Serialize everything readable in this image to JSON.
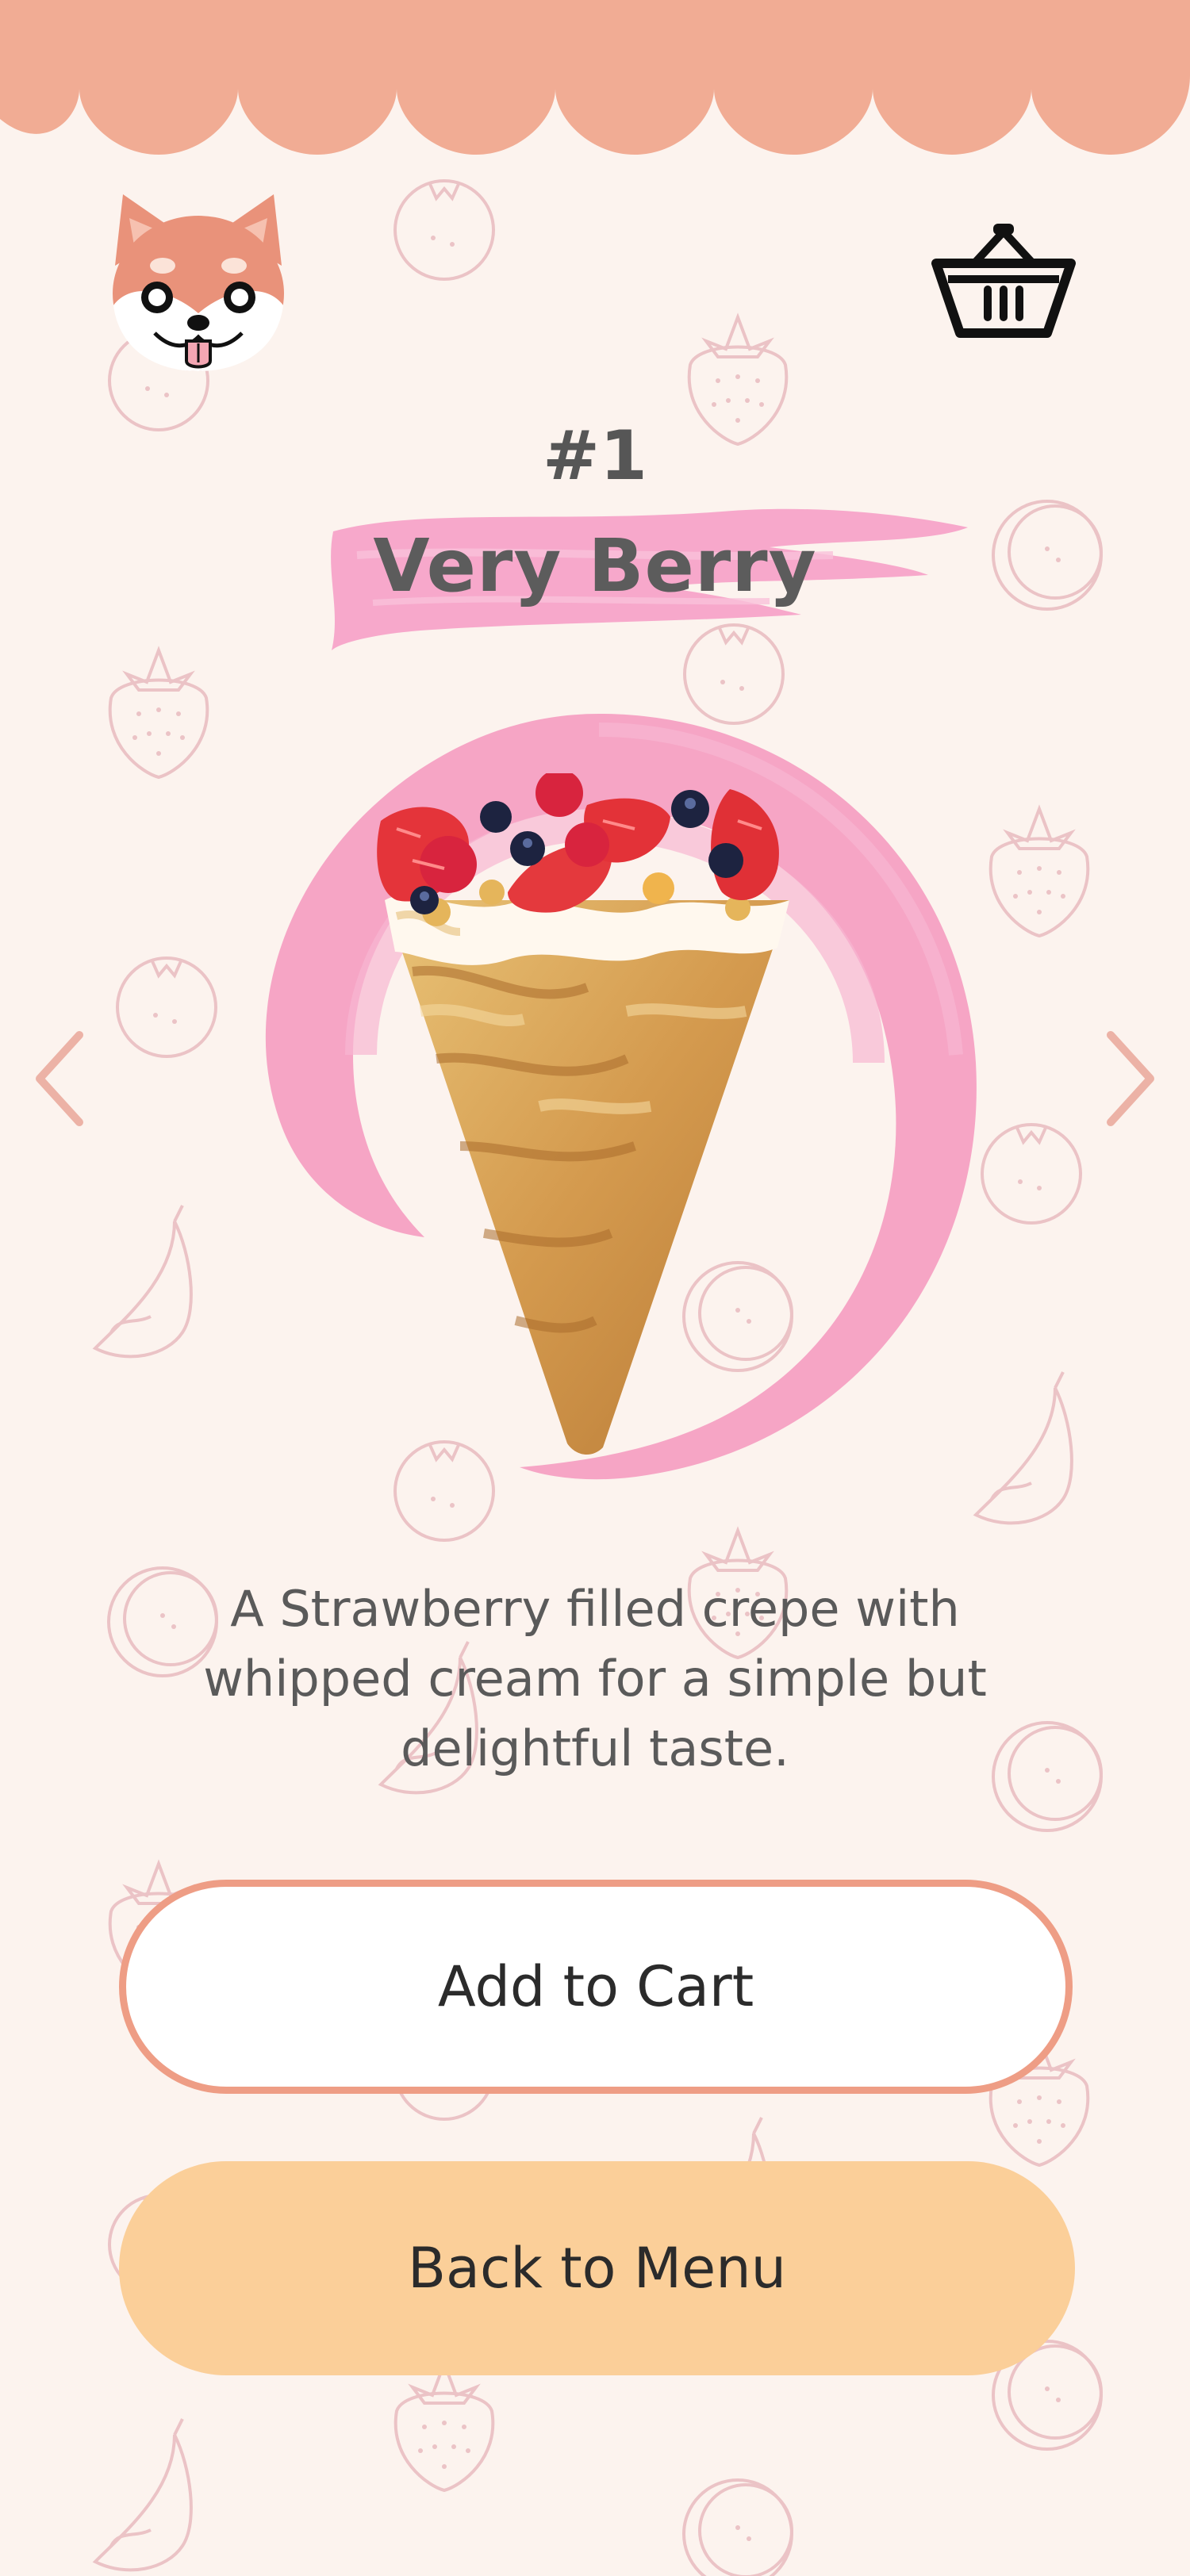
{
  "product": {
    "rank": "#1",
    "name": "Very Berry",
    "description": "A Strawberry filled crepe with whipped cream for a simple but delightful taste."
  },
  "actions": {
    "add_to_cart_label": "Add to Cart",
    "back_to_menu_label": "Back to Menu"
  },
  "icons": {
    "avatar": "shiba-dog-avatar-icon",
    "cart": "shopping-basket-icon",
    "prev": "chevron-left-icon",
    "next": "chevron-right-icon"
  },
  "colors": {
    "background": "#fcf3ee",
    "header_scallop": "#f1ac94",
    "accent_pink": "#f59ec1",
    "add_button_border": "#ee9d85",
    "back_button_fill": "#fbcf99",
    "pattern_line": "#ecc4c4",
    "title_text": "#5c5c5c"
  }
}
